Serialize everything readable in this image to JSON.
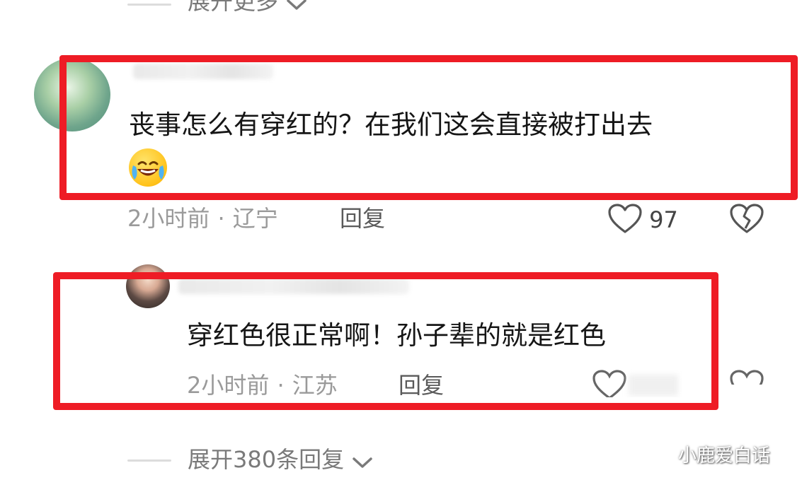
{
  "top_expand": {
    "label": "展开更多"
  },
  "comments": [
    {
      "text_line1": "丧事怎么有穿红的？在我们这会直接被打出去",
      "time": "2小时前",
      "separator": "·",
      "location": "辽宁",
      "reply_label": "回复",
      "like_count": "97",
      "emoji": "crying-laughing-face"
    },
    {
      "text_line1": "穿红色很正常啊！孙子辈的就是红色",
      "time": "2小时前",
      "separator": "·",
      "location": "江苏",
      "reply_label": "回复",
      "like_count": "",
      "reply_count_label": "展开380条回复"
    }
  ],
  "watermark": {
    "text": "小鹿爱白话"
  },
  "colors": {
    "highlight": "#ee1c25",
    "meta": "#9a9a9a"
  }
}
